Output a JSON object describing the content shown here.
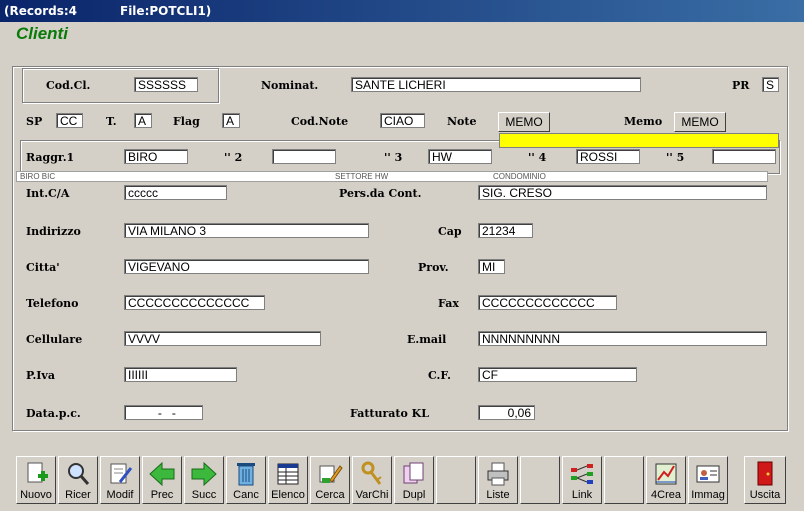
{
  "window": {
    "records": "(Records:4",
    "file": "File:POTCLI1)"
  },
  "app_title": "Clienti",
  "labels": {
    "cod_cl": "Cod.Cl.",
    "nominat": "Nominat.",
    "pr": "PR",
    "sp": "SP",
    "t": "T.",
    "flag": "Flag",
    "cod_note": "Cod.Note",
    "note": "Note",
    "memo": "Memo",
    "raggr1": "Raggr.1",
    "r2": "'' 2",
    "r3": "'' 3",
    "r4": "'' 4",
    "r5": "'' 5",
    "int_ca": "Int.C/A",
    "pers_cont": "Pers.da Cont.",
    "indirizzo": "Indirizzo",
    "cap": "Cap",
    "citta": "Citta'",
    "prov": "Prov.",
    "telefono": "Telefono",
    "fax": "Fax",
    "cellulare": "Cellulare",
    "email": "E.mail",
    "piva": "P.Iva",
    "cf": "C.F.",
    "data_pc": "Data.p.c.",
    "fatturato": "Fatturato KL"
  },
  "fields": {
    "cod_cl": "SSSSSS",
    "nominat": "SANTE LICHERI",
    "pr": "S",
    "sp": "CC",
    "t": "A",
    "flag": "A",
    "cod_note": "CIAO",
    "raggr1": "BIRO",
    "r2": "",
    "r3": "HW",
    "r4": "ROSSI",
    "r5": "",
    "int_ca": "ccccc",
    "pers_cont": "SIG. CRESO",
    "indirizzo": "VIA MILANO 3",
    "cap": "21234",
    "citta": "VIGEVANO",
    "prov": "MI",
    "telefono": "CCCCCCCCCCCCCC",
    "fax": "CCCCCCCCCCCCC",
    "cellulare": "VVVV",
    "email": "NNNNNNNNN",
    "piva": "IIIIII",
    "cf": "CF",
    "data_pc": "  -   -",
    "fatturato": "0,06"
  },
  "memo_buttons": {
    "note": "MEMO",
    "memo": "MEMO"
  },
  "raggr_strip": {
    "a": "BIRO BIC",
    "b": "SETTORE HW",
    "c": "CONDOMINIO"
  },
  "toolbar": [
    {
      "label": "Nuovo",
      "icon": "new-document-icon"
    },
    {
      "label": "Ricer",
      "icon": "search-icon"
    },
    {
      "label": "Modif",
      "icon": "edit-icon"
    },
    {
      "label": "Prec",
      "icon": "arrow-left-icon"
    },
    {
      "label": "Succ",
      "icon": "arrow-right-icon"
    },
    {
      "label": "Canc",
      "icon": "trash-icon"
    },
    {
      "label": "Elenco",
      "icon": "list-icon"
    },
    {
      "label": "Cerca",
      "icon": "find-icon"
    },
    {
      "label": "VarChi",
      "icon": "keys-icon"
    },
    {
      "label": "Dupl",
      "icon": "duplicate-icon"
    },
    {
      "label": "",
      "icon": ""
    },
    {
      "label": "Liste",
      "icon": "printer-icon"
    },
    {
      "label": "",
      "icon": ""
    },
    {
      "label": "Link",
      "icon": "link-icon"
    },
    {
      "label": "",
      "icon": ""
    },
    {
      "label": "4Crea",
      "icon": "create-icon"
    },
    {
      "label": "Immag",
      "icon": "image-icon"
    },
    {
      "label": "Uscita",
      "icon": "exit-door-icon"
    }
  ]
}
